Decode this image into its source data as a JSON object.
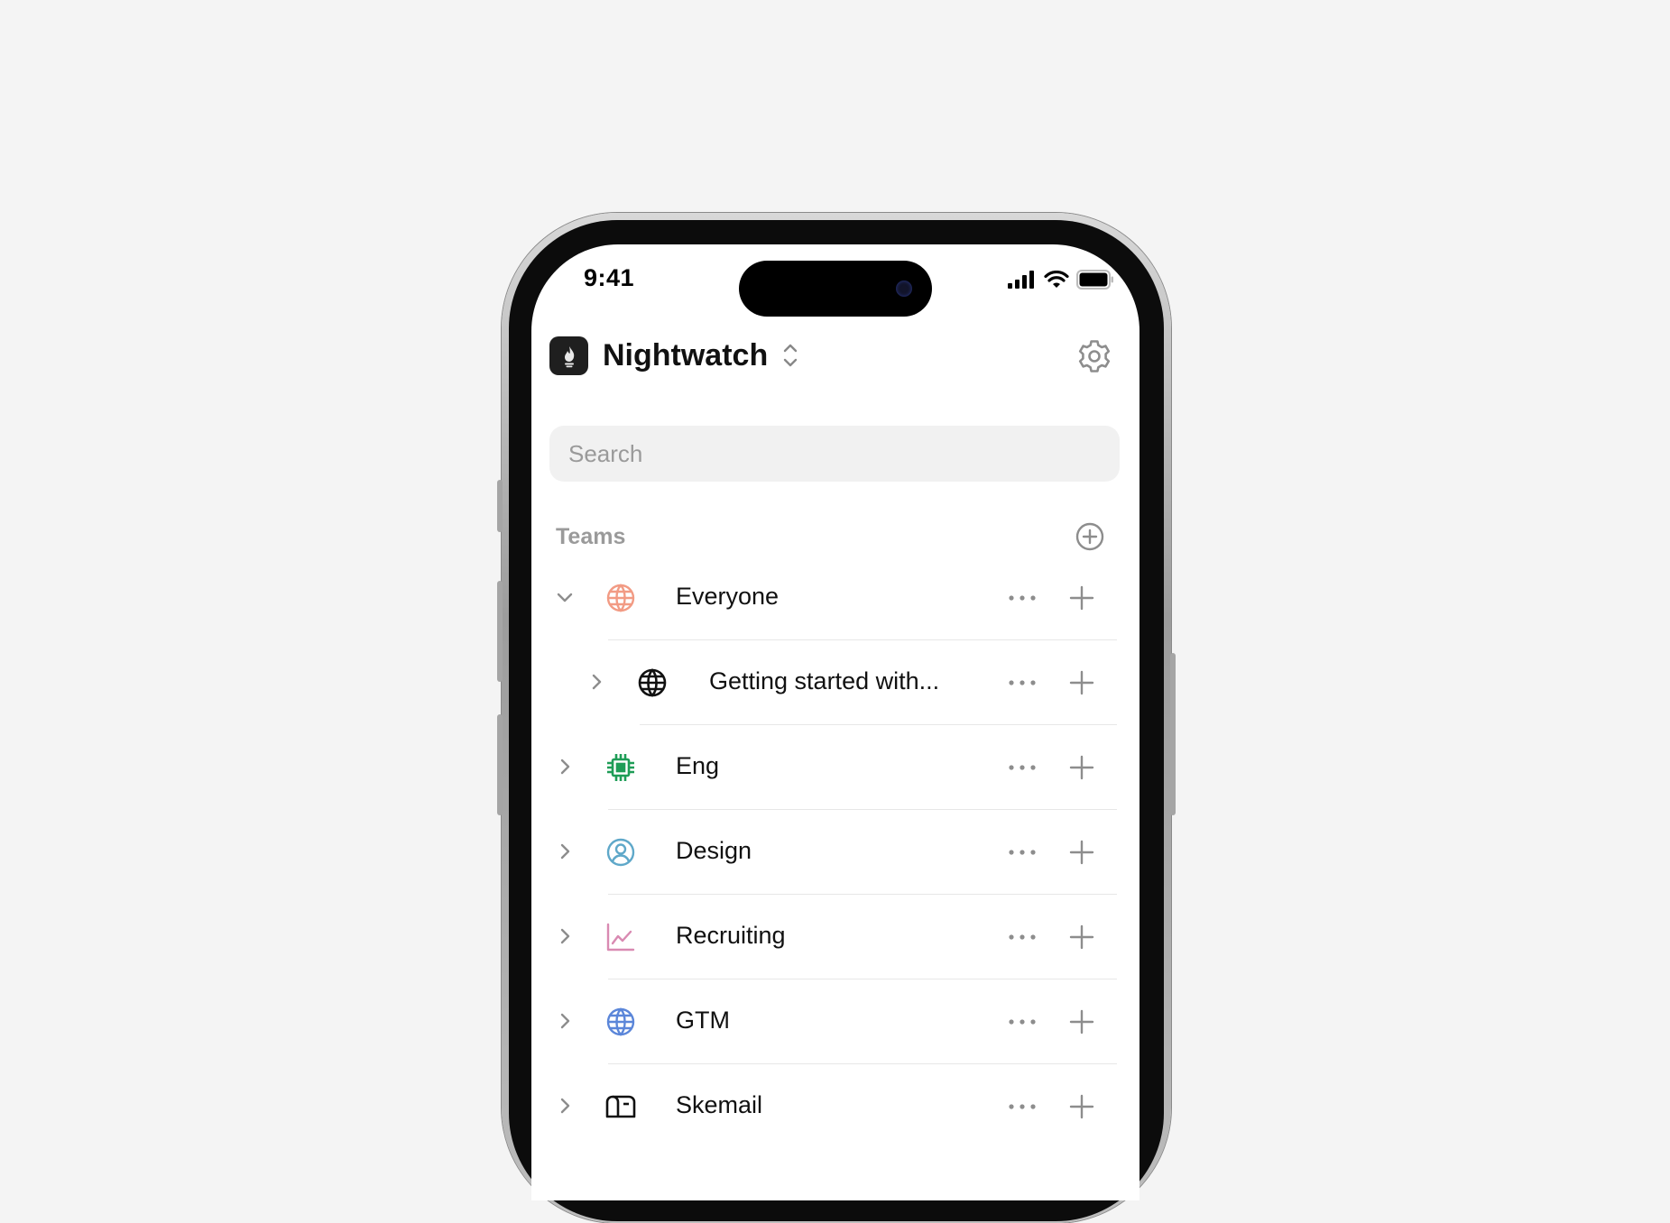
{
  "status_bar": {
    "time": "9:41"
  },
  "header": {
    "app_name": "Nightwatch",
    "logo_icon": "flame-logo-icon",
    "switcher_icon": "chevron-up-down-icon",
    "settings_icon": "gear-icon"
  },
  "search": {
    "placeholder": "Search",
    "value": ""
  },
  "teams_section": {
    "title": "Teams",
    "add_icon": "plus-circle-icon",
    "items": [
      {
        "label": "Everyone",
        "icon": "globe-icon",
        "icon_color": "#f29b84",
        "expanded": true,
        "level": 0
      },
      {
        "label": "Getting started with...",
        "icon": "globe-icon",
        "icon_color": "#111111",
        "expanded": false,
        "level": 1
      },
      {
        "label": "Eng",
        "icon": "chip-icon",
        "icon_color": "#1f9d57",
        "expanded": false,
        "level": 0
      },
      {
        "label": "Design",
        "icon": "user-circle-icon",
        "icon_color": "#5fa8c9",
        "expanded": false,
        "level": 0
      },
      {
        "label": "Recruiting",
        "icon": "line-chart-icon",
        "icon_color": "#d98ab2",
        "expanded": false,
        "level": 0
      },
      {
        "label": "GTM",
        "icon": "globe-icon",
        "icon_color": "#5b86d9",
        "expanded": false,
        "level": 0
      },
      {
        "label": "Skemail",
        "icon": "mailbox-icon",
        "icon_color": "#111111",
        "expanded": false,
        "level": 0
      }
    ]
  }
}
